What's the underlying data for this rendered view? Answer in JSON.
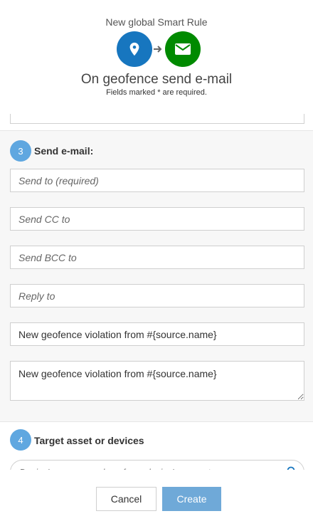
{
  "header": {
    "title": "New global Smart Rule",
    "rule_title": "On geofence send e-mail",
    "required_note": "Fields marked * are required.",
    "trigger_icon": "location-pin-icon",
    "action_icon": "envelope-icon",
    "colors": {
      "trigger": "#1776bf",
      "action": "#008a00"
    }
  },
  "section3": {
    "step": "3",
    "title": "Send e-mail:",
    "send_to": {
      "placeholder": "Send to (required)",
      "value": ""
    },
    "send_cc": {
      "placeholder": "Send CC to",
      "value": ""
    },
    "send_bcc": {
      "placeholder": "Send BCC to",
      "value": ""
    },
    "reply_to": {
      "placeholder": "Reply to",
      "value": ""
    },
    "subject": {
      "value": "New geofence violation from #{source.name}"
    },
    "body": {
      "value": "New geofence violation from #{source.name}"
    }
  },
  "section4": {
    "step": "4",
    "title": "Target asset or devices",
    "search": {
      "placeholder": "Device's name or value of any device's property"
    }
  },
  "footer": {
    "cancel_label": "Cancel",
    "create_label": "Create"
  }
}
